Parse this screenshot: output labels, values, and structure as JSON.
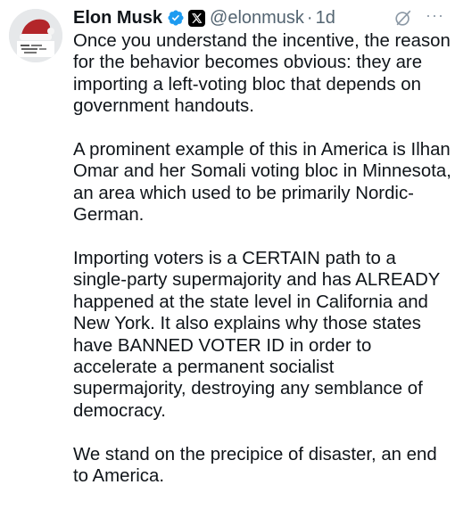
{
  "author": {
    "name": "Elon Musk",
    "handle": "@elonmusk",
    "separator": "·",
    "time": "1d"
  },
  "colors": {
    "verified_badge": "#1d9bf0",
    "secondary_text": "#536471",
    "primary_text": "#0f1419"
  },
  "icons": {
    "verified": "verified-checkmark-icon",
    "affiliation": "x-logo-badge-icon",
    "grok": "grok-icon",
    "more": "more-options-icon"
  },
  "more_label": "···",
  "tweet": {
    "paragraphs": [
      "Once you understand the incentive, the reason for the behavior becomes obvious: they are importing a left-voting bloc that depends on government handouts.",
      "A prominent example of this in America is Ilhan Omar and her Somali voting bloc in Minnesota, an area which used to be primarily Nordic-German.",
      "Importing voters is a CERTAIN path to a single-party supermajority and has ALREADY happened at the state level in California and New York. It also explains why those states have BANNED VOTER ID in order to accelerate a permanent socialist supermajority, destroying any semblance of democracy.",
      "We stand on the precipice of disaster, an end to America."
    ]
  }
}
